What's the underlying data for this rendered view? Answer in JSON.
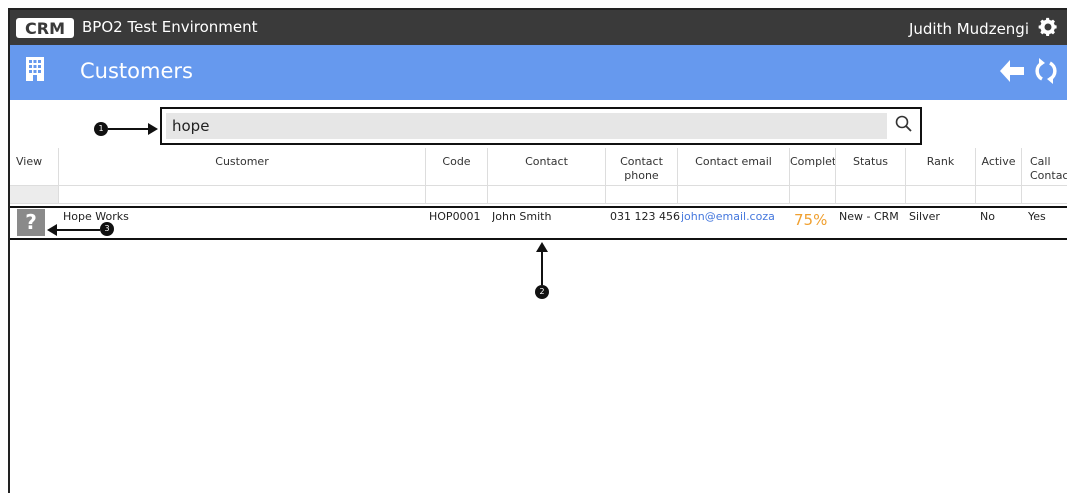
{
  "topbar": {
    "logo_text": "CRM",
    "environment": "BPO2 Test Environment",
    "user": "Judith Mudzengi",
    "settings_icon": "gear-icon"
  },
  "header": {
    "title": "Customers",
    "icon": "building-icon",
    "back_icon": "back-arrow-icon",
    "refresh_icon": "refresh-icon",
    "color": "#6699ee"
  },
  "search": {
    "value": "hope",
    "placeholder": "",
    "icon": "search-icon"
  },
  "callouts": [
    "1",
    "2",
    "3"
  ],
  "table": {
    "columns": [
      "View",
      "Customer",
      "Code",
      "Contact",
      "Contact phone",
      "Contact email",
      "Complet",
      "Status",
      "Rank",
      "Active",
      "Call Contact"
    ],
    "rows": [
      {
        "view_icon": "?",
        "customer": "Hope Works",
        "code": "HOP0001",
        "contact": "John Smith",
        "phone": "031 123 456",
        "email": "john@email.coza",
        "complete": "75%",
        "status": "New - CRM",
        "rank": "Silver",
        "active": "No",
        "call_contact": "Yes"
      }
    ]
  },
  "colors": {
    "topbar": "#3a3a3a",
    "accent": "#6699ee",
    "complete": "#f0a030",
    "link": "#4477dd"
  }
}
